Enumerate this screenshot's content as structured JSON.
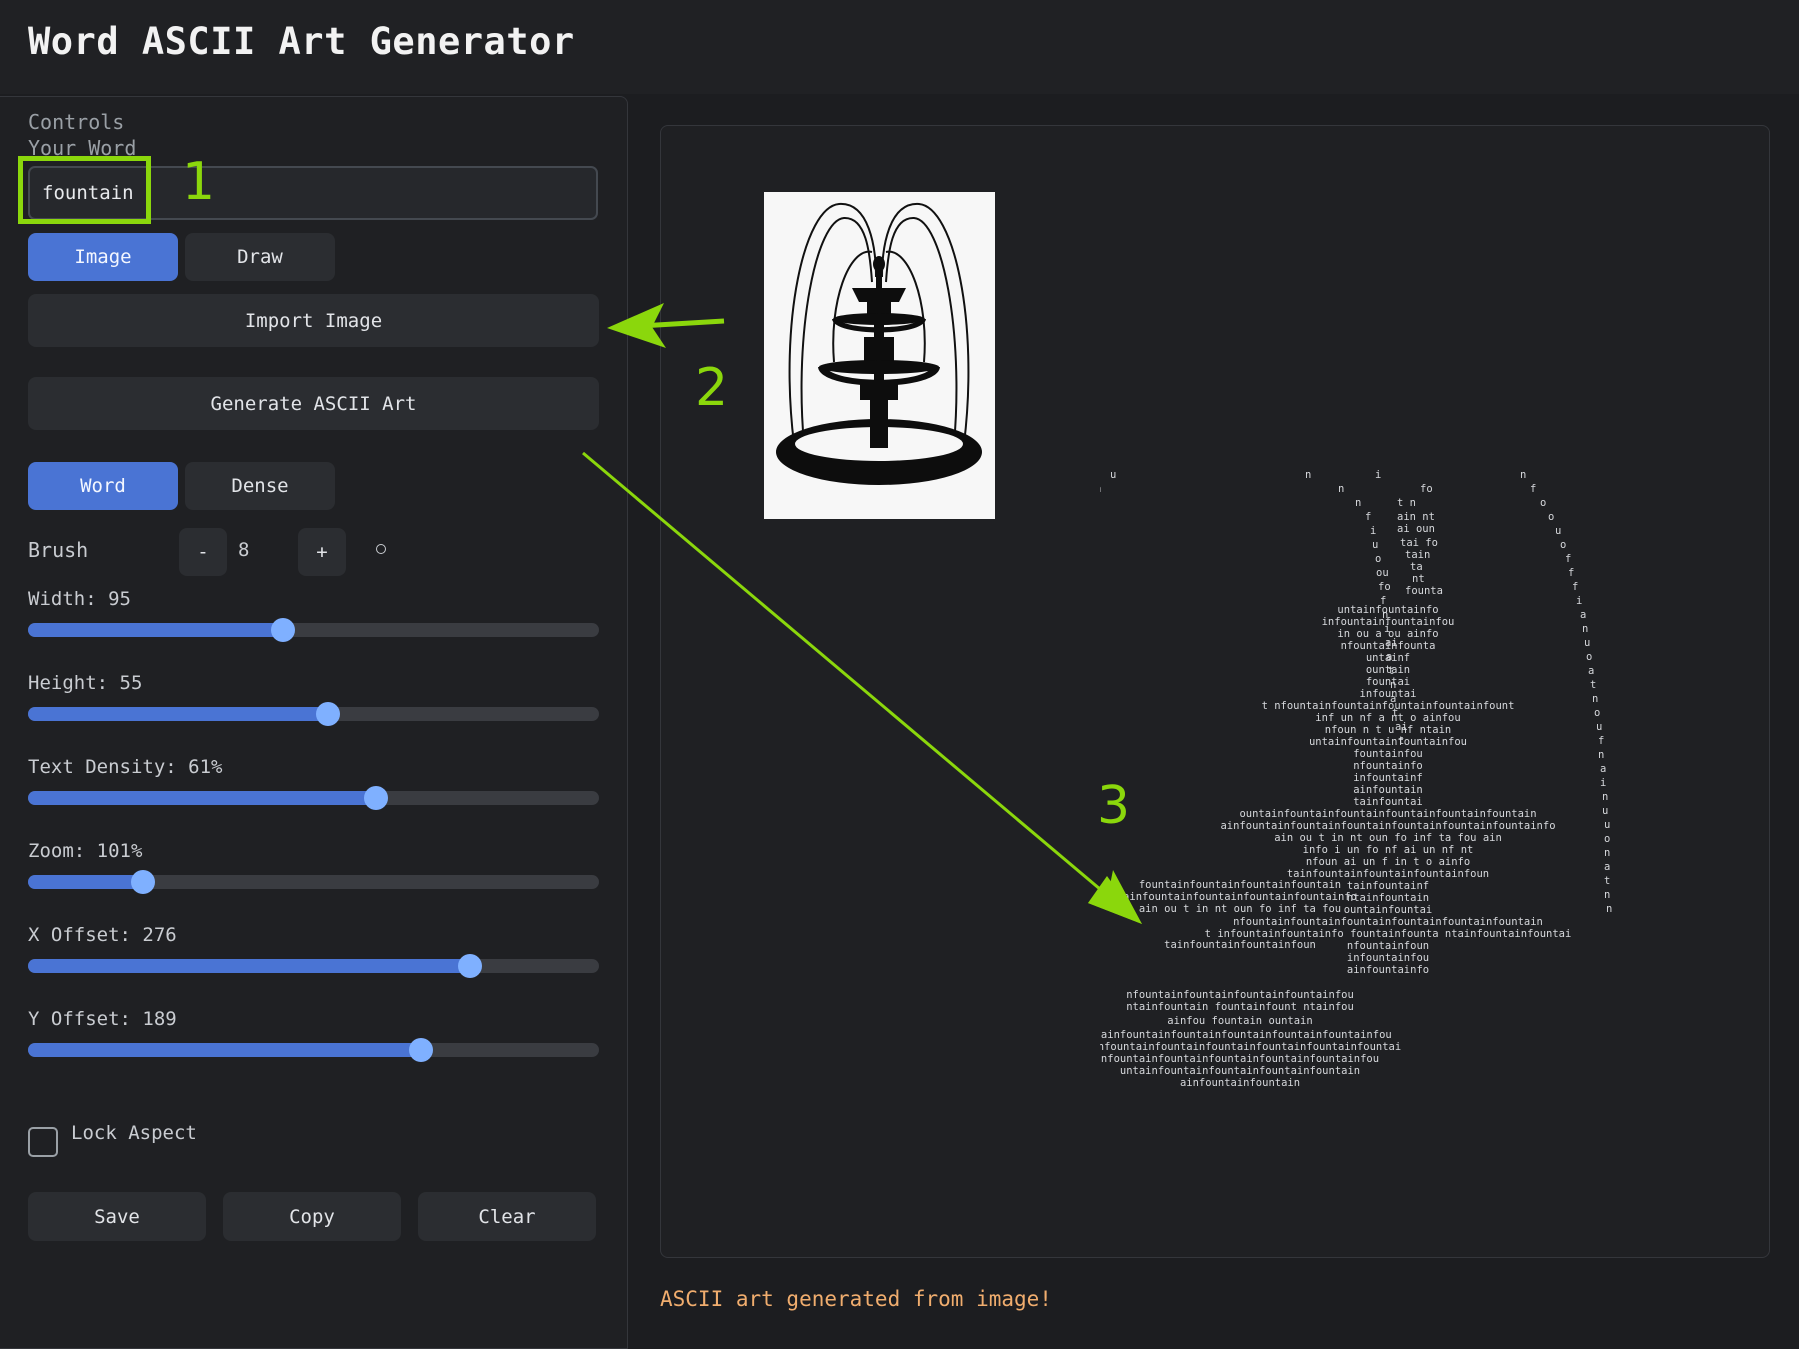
{
  "app": {
    "title": "Word ASCII Art Generator"
  },
  "controls": {
    "section_title": "Controls",
    "word_label": "Your Word",
    "word_value": "fountain",
    "source_tabs": [
      {
        "label": "Image",
        "active": true
      },
      {
        "label": "Draw",
        "active": false
      }
    ],
    "import_label": "Import Image",
    "generate_label": "Generate ASCII Art",
    "mode_tabs": [
      {
        "label": "Word",
        "active": true
      },
      {
        "label": "Dense",
        "active": false
      }
    ],
    "brush": {
      "label": "Brush",
      "minus": "-",
      "value": "8",
      "plus": "+"
    },
    "sliders": [
      {
        "label": "Width: 95",
        "fraction": 0.447
      },
      {
        "label": "Height: 55",
        "fraction": 0.526
      },
      {
        "label": "Text Density: 61%",
        "fraction": 0.609
      },
      {
        "label": "Zoom: 101%",
        "fraction": 0.202
      },
      {
        "label": "X Offset: 276",
        "fraction": 0.774
      },
      {
        "label": "Y Offset: 189",
        "fraction": 0.689
      }
    ],
    "lock_aspect": {
      "label": "Lock Aspect",
      "checked": false
    },
    "actions": {
      "save": "Save",
      "copy": "Copy",
      "clear": "Clear"
    }
  },
  "status": "ASCII art generated from image!",
  "annotations": {
    "n1": "1",
    "n2": "2",
    "n3": "3"
  },
  "colors": {
    "accent": "#4a74d4",
    "thumb": "#7fb0ff",
    "annotation": "#8bd70c",
    "status": "#f0ad6e"
  }
}
